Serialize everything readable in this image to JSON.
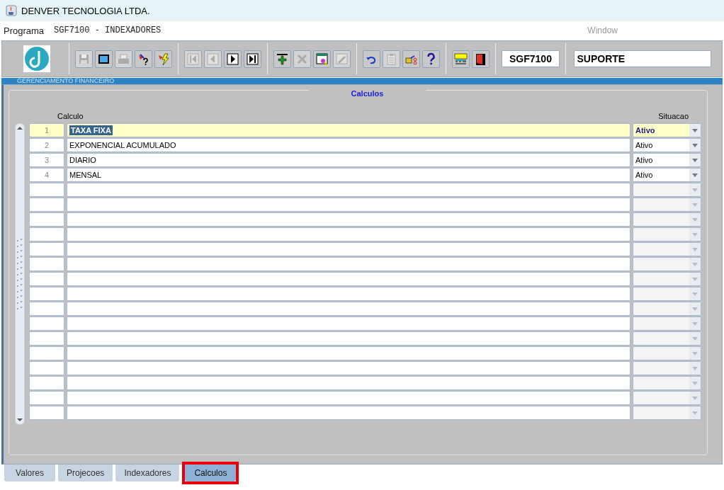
{
  "window": {
    "title": "DENVER TECNOLOGIA LTDA."
  },
  "menu": [
    {
      "label": "Programa",
      "disabled": false
    },
    {
      "label": "SGF7100 - INDEXADORES",
      "disabled": false
    },
    {
      "label": "Window",
      "disabled": true
    }
  ],
  "toolbar": {
    "groups": [
      [
        {
          "kind": "save",
          "disabled": true
        },
        {
          "kind": "window",
          "disabled": false
        },
        {
          "kind": "print",
          "disabled": true
        },
        {
          "kind": "query",
          "disabled": false
        },
        {
          "kind": "execute",
          "disabled": false
        }
      ],
      [
        {
          "kind": "first",
          "disabled": true
        },
        {
          "kind": "prev",
          "disabled": true
        },
        {
          "kind": "next",
          "disabled": false
        },
        {
          "kind": "last",
          "disabled": false
        }
      ],
      [
        {
          "kind": "insert",
          "disabled": false
        },
        {
          "kind": "delete",
          "disabled": true
        },
        {
          "kind": "edit",
          "disabled": false
        },
        {
          "kind": "clear",
          "disabled": true
        }
      ],
      [
        {
          "kind": "undo",
          "disabled": false
        },
        {
          "kind": "paste",
          "disabled": true
        },
        {
          "kind": "hand",
          "disabled": false
        },
        {
          "kind": "help",
          "disabled": false
        }
      ],
      [
        {
          "kind": "menu",
          "disabled": false
        },
        {
          "kind": "exit",
          "disabled": false
        }
      ]
    ],
    "program_code": "SGF7100",
    "user": "SUPORTE"
  },
  "section_title": "GERENCIAMENTO FINANCEIRO",
  "frame": {
    "title": "Calculos"
  },
  "table": {
    "columns": [
      "Calculo",
      "Situacao"
    ],
    "rows": [
      {
        "number": "1",
        "calculo": "TAXA FIXA",
        "situacao": "Ativo",
        "selected": true
      },
      {
        "number": "2",
        "calculo": "EXPONENCIAL ACUMULADO",
        "situacao": "Ativo",
        "selected": false
      },
      {
        "number": "3",
        "calculo": "DIARIO",
        "situacao": "Ativo",
        "selected": false
      },
      {
        "number": "4",
        "calculo": "MENSAL",
        "situacao": "Ativo",
        "selected": false
      }
    ]
  },
  "tabs": [
    {
      "label": "Valores",
      "selected": false,
      "highlighted": false
    },
    {
      "label": "Projecoes",
      "selected": false,
      "highlighted": false
    },
    {
      "label": "Indexadores",
      "selected": false,
      "highlighted": false
    },
    {
      "label": "Calculos",
      "selected": true,
      "highlighted": true
    }
  ]
}
